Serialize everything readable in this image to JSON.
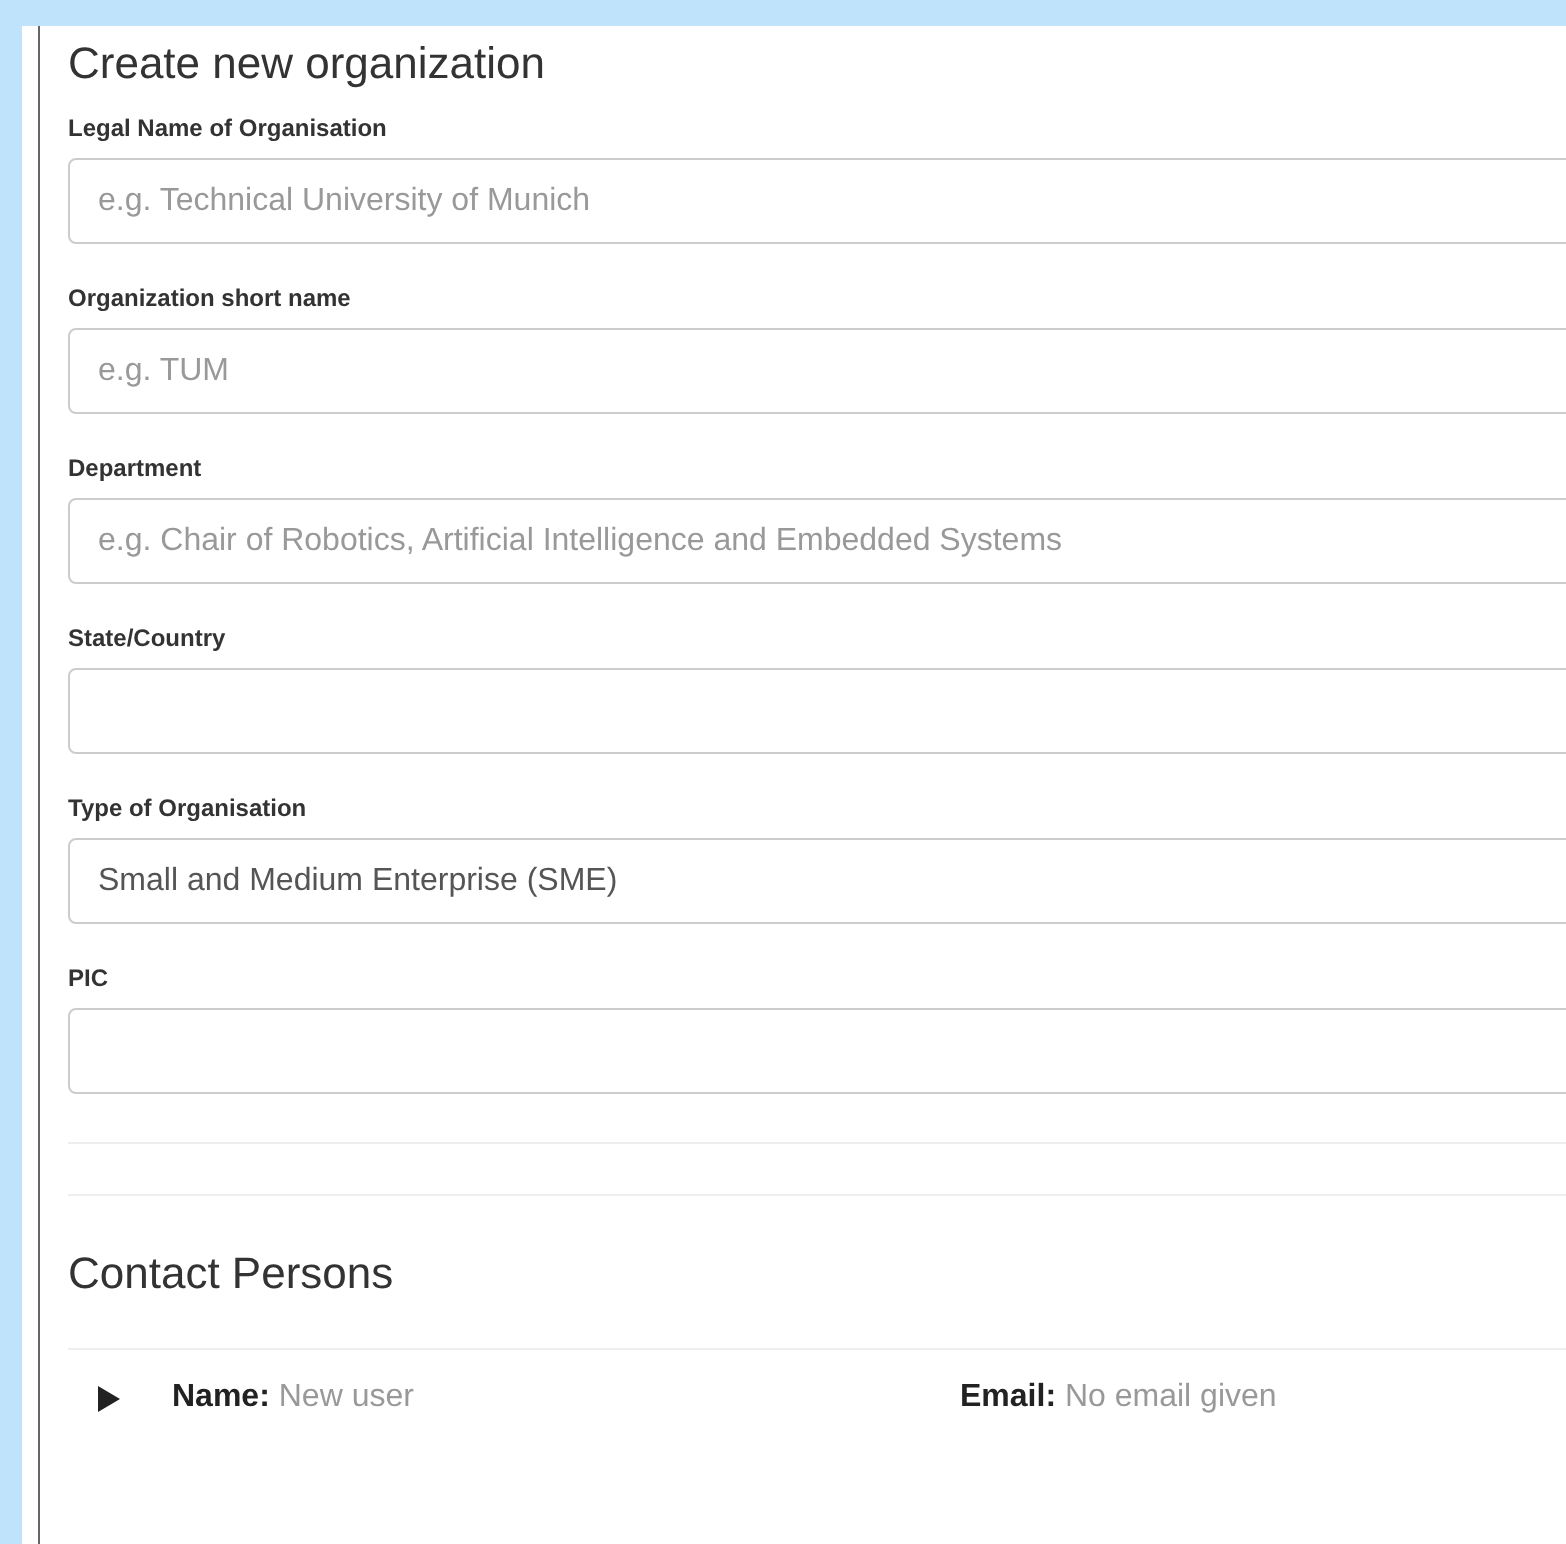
{
  "title": "Create new organization",
  "fields": [
    {
      "label": "Legal Name of Organisation",
      "placeholder": "e.g. Technical University of Munich"
    },
    {
      "label": "Organization short name",
      "placeholder": "e.g. TUM"
    },
    {
      "label": "Department",
      "placeholder": "e.g. Chair of Robotics, Artificial Intelligence and Embedded Systems"
    },
    {
      "label": "State/Country"
    },
    {
      "label": "Type of Organisation",
      "value": "Small and Medium Enterprise (SME)"
    },
    {
      "label": "PIC"
    }
  ],
  "contacts": {
    "heading": "Contact Persons",
    "rows": [
      {
        "expanded": false,
        "name_label": "Name:",
        "name": "New user",
        "email_label": "Email:",
        "email": "No email given"
      }
    ]
  }
}
